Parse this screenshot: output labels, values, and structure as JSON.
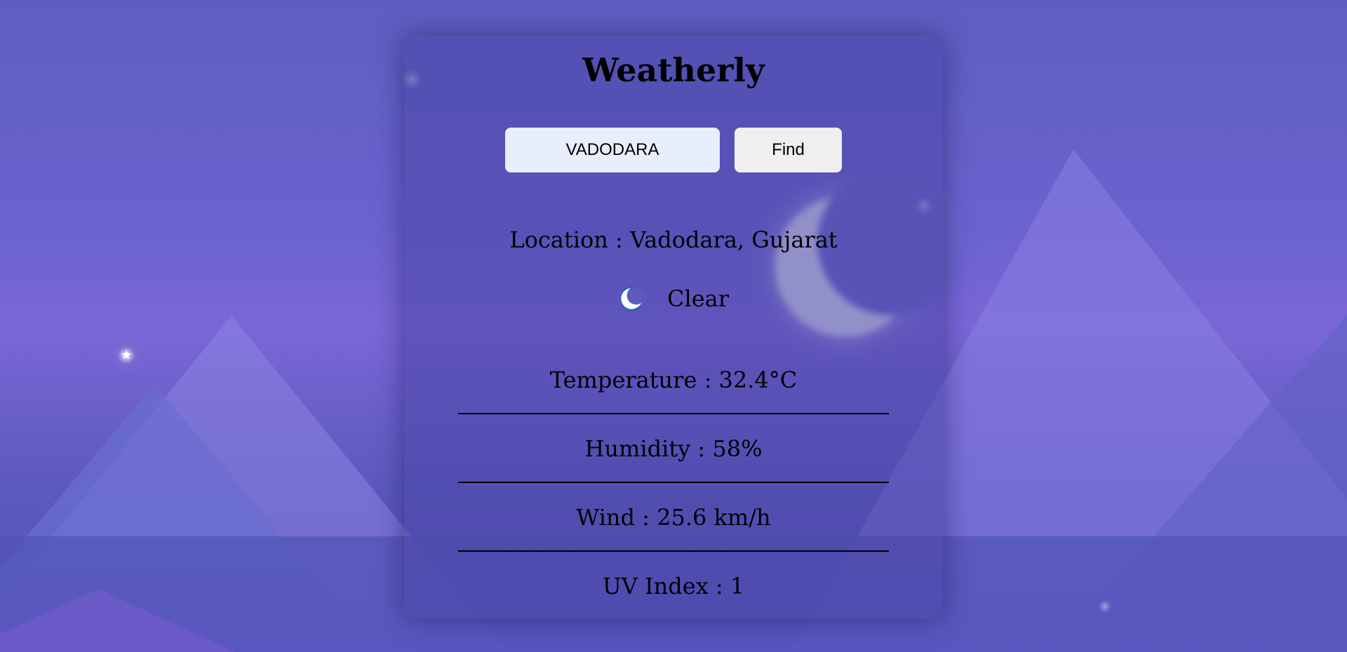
{
  "app": {
    "title": "Weatherly"
  },
  "search": {
    "value": "VADODARA",
    "button_label": "Find"
  },
  "location": {
    "text": "Location :  Vadodara,  Gujarat"
  },
  "condition": {
    "icon": "moon-icon",
    "label": "Clear"
  },
  "metrics": {
    "temperature": "Temperature : 32.4°C",
    "humidity": "Humidity : 58%",
    "wind": "Wind : 25.6 km/h",
    "uv": "UV Index : 1"
  },
  "colors": {
    "background": "#6b63cf",
    "card": "#4846a5",
    "input_bg": "#e8eefc",
    "button_bg": "#efefef",
    "icon_blue": "#1976d2"
  }
}
